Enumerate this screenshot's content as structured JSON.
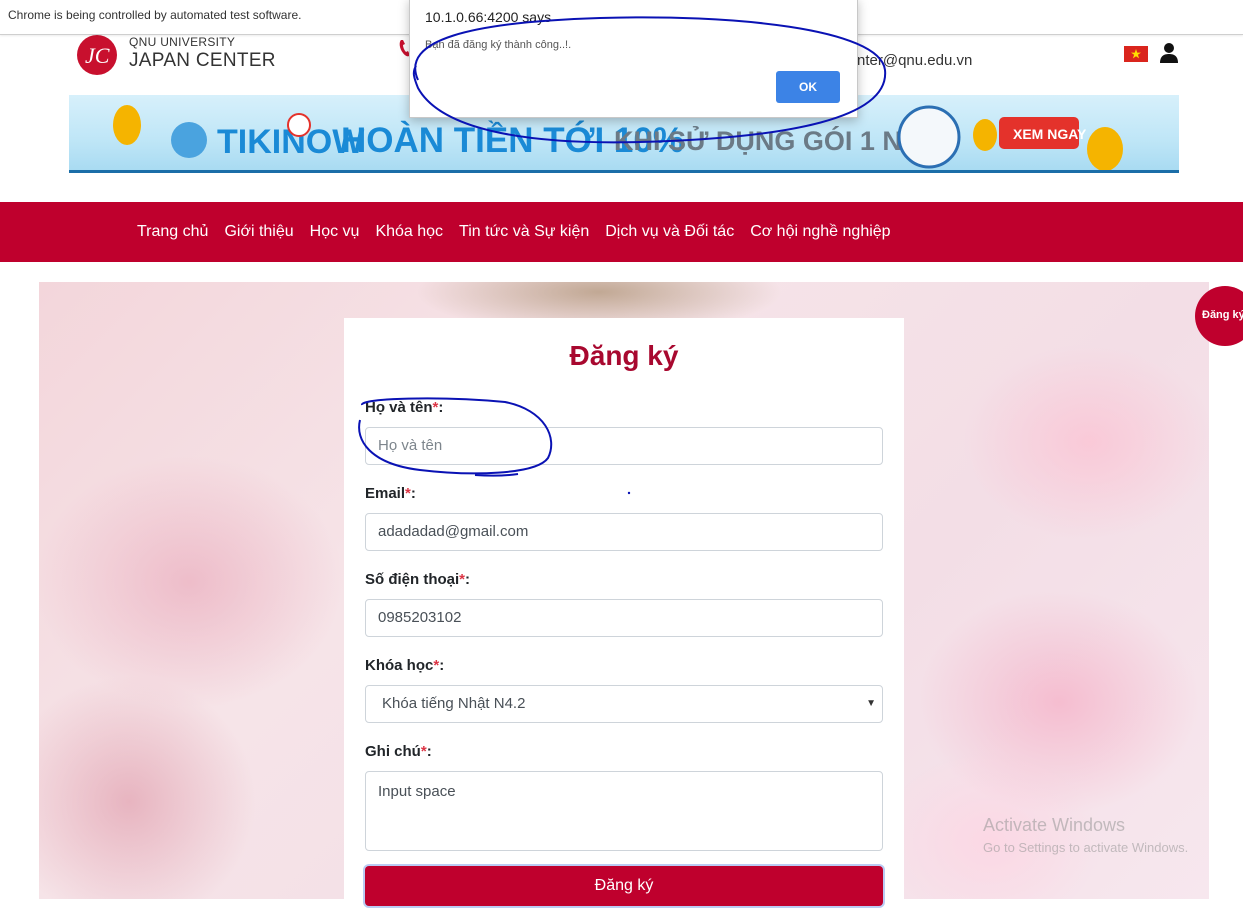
{
  "browser": {
    "infobar_text": "Chrome is being controlled by automated test software."
  },
  "header": {
    "logo_mark": "JC",
    "logo_small": "QNU UNIVERSITY",
    "logo_big": "JAPAN CENTER",
    "email_partial": "nter@qnu.edu.vn",
    "language_flag": "vietnam-flag-icon",
    "user_icon": "user-icon"
  },
  "banner": {
    "brand": "TIKINOW",
    "headline": "HOÀN TIỀN TỚI 10%",
    "subline": "KHI SỬ DỤNG GÓI 1 NĂM",
    "cta": "XEM NGAY"
  },
  "nav": {
    "items": [
      {
        "label": "Trang chủ"
      },
      {
        "label": "Giới thiệu"
      },
      {
        "label": "Học vụ"
      },
      {
        "label": "Khóa học"
      },
      {
        "label": "Tin tức và Sự kiện"
      },
      {
        "label": "Dịch vụ và Đối tác"
      },
      {
        "label": "Cơ hội nghề nghiệp"
      }
    ]
  },
  "side_badge": {
    "label": "Đăng ký"
  },
  "form": {
    "title": "Đăng ký",
    "required_mark": "*",
    "name": {
      "label": "Họ và tên",
      "placeholder": "Họ và tên",
      "value": ""
    },
    "email": {
      "label": "Email",
      "value": "adadadad@gmail.com"
    },
    "phone": {
      "label": "Số điện thoại",
      "value": "0985203102"
    },
    "course": {
      "label": "Khóa học",
      "selected": "Khóa tiếng Nhật N4.2"
    },
    "note": {
      "label": "Ghi chú",
      "value": "Input space"
    },
    "submit_label": "Đăng ký"
  },
  "dialog": {
    "title": "10.1.0.66:4200 says",
    "message": "Bạn đã đăng ký thành công..!.",
    "ok_label": "OK"
  },
  "watermark": {
    "line1": "Activate Windows",
    "line2": "Go to Settings to activate Windows."
  },
  "colors": {
    "brand_red": "#bf002d",
    "title_red": "#a8082f",
    "dialog_button": "#3c83e6",
    "annotation_ink": "#0a12b4"
  }
}
